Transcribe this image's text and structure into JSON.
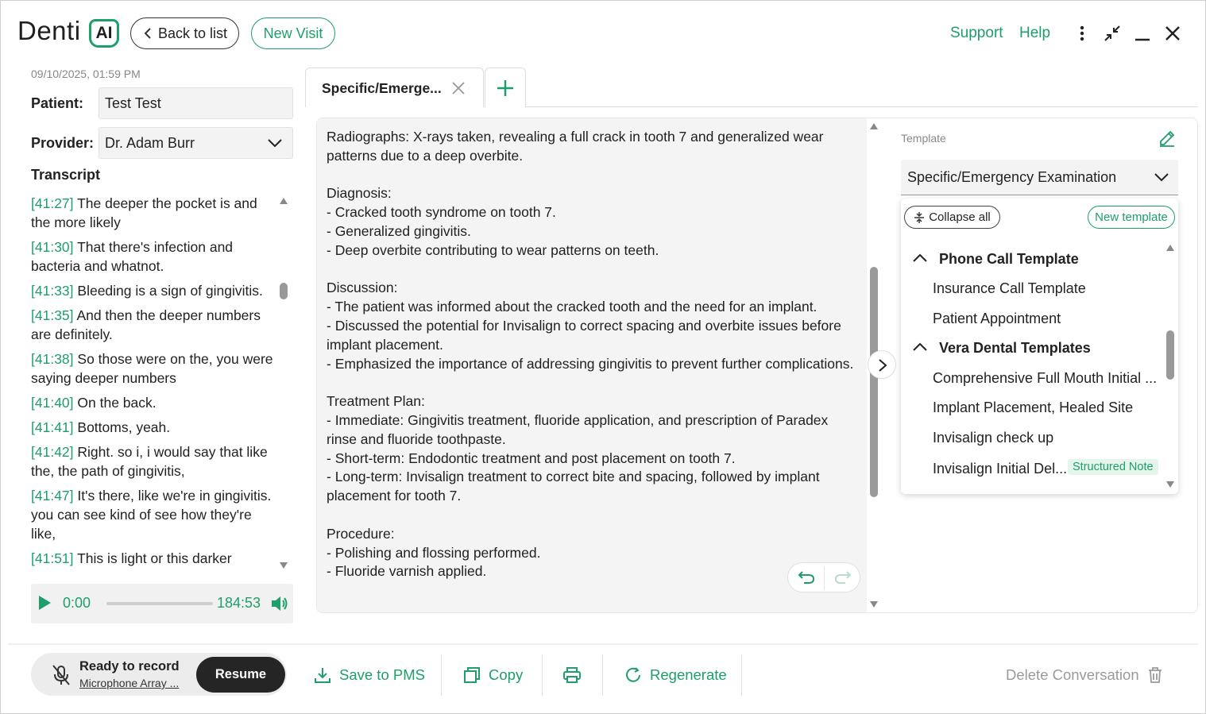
{
  "header": {
    "logo_text": "Denti",
    "logo_badge": "AI",
    "back_label": "Back to list",
    "new_visit_label": "New Visit",
    "support_label": "Support",
    "help_label": "Help"
  },
  "visit": {
    "datetime": "09/10/2025, 01:59 PM",
    "patient_label": "Patient:",
    "patient_value": "Test Test",
    "provider_label": "Provider:",
    "provider_value": "Dr. Adam Burr",
    "transcript_label": "Transcript"
  },
  "transcript": [
    {
      "time": "[41:27]",
      "text": "The deeper the pocket is and the more likely"
    },
    {
      "time": "[41:30]",
      "text": "That there's infection and bacteria and whatnot."
    },
    {
      "time": "[41:33]",
      "text": "Bleeding is a sign of gingivitis."
    },
    {
      "time": "[41:35]",
      "text": "And then the deeper numbers are definitely."
    },
    {
      "time": "[41:38]",
      "text": "So those were on the, you were saying deeper numbers"
    },
    {
      "time": "[41:40]",
      "text": "On the back."
    },
    {
      "time": "[41:41]",
      "text": "Bottoms, yeah."
    },
    {
      "time": "[41:42]",
      "text": "Right. so i, i would say that like the, the path of gingivitis,"
    },
    {
      "time": "[41:47]",
      "text": "It's there, like we're in gingivitis. you can see kind of see how they're like,"
    },
    {
      "time": "[41:51]",
      "text": "This is light or this darker"
    }
  ],
  "player": {
    "current": "0:00",
    "total": "184:53",
    "progress": 0
  },
  "tabs": {
    "active_label": "Specific/Emerge..."
  },
  "note": {
    "text": "Radiographs: X-rays taken, revealing a full crack in tooth 7 and generalized wear patterns due to a deep overbite.\n\nDiagnosis:\n- Cracked tooth syndrome on tooth 7.\n- Generalized gingivitis.\n- Deep overbite contributing to wear patterns on teeth.\n\nDiscussion:\n- The patient was informed about the cracked tooth and the need for an implant.\n- Discussed the potential for Invisalign to correct spacing and overbite issues before implant placement.\n- Emphasized the importance of addressing gingivitis to prevent further complications.\n\nTreatment Plan:\n- Immediate: Gingivitis treatment, fluoride application, and prescription of Paradex rinse and fluoride toothpaste.\n- Short-term: Endodontic treatment and post placement on tooth 7.\n- Long-term: Invisalign treatment to correct bite and spacing, followed by implant placement for tooth 7.\n\nProcedure:\n- Polishing and flossing performed.\n- Fluoride varnish applied."
  },
  "template": {
    "label": "Template",
    "selected": "Specific/Emergency Examination",
    "collapse_all": "Collapse all",
    "new_template": "New template",
    "groups": [
      {
        "name": "Phone Call Template",
        "items": [
          "Insurance Call Template",
          "Patient Appointment"
        ]
      },
      {
        "name": "Vera Dental Templates",
        "items": [
          "Comprehensive Full Mouth Initial ...",
          "Implant Placement, Healed Site",
          "Invisalign check up",
          "Invisalign Initial Del..."
        ]
      }
    ],
    "structured_badge": "Structured Note"
  },
  "recorder": {
    "status": "Ready to record",
    "device": "Microphone Array ...",
    "resume_label": "Resume"
  },
  "actions": {
    "save_pms": "Save to PMS",
    "copy": "Copy",
    "regenerate": "Regenerate",
    "delete": "Delete Conversation"
  },
  "colors": {
    "accent": "#1e9e6a",
    "dark": "#252525"
  }
}
